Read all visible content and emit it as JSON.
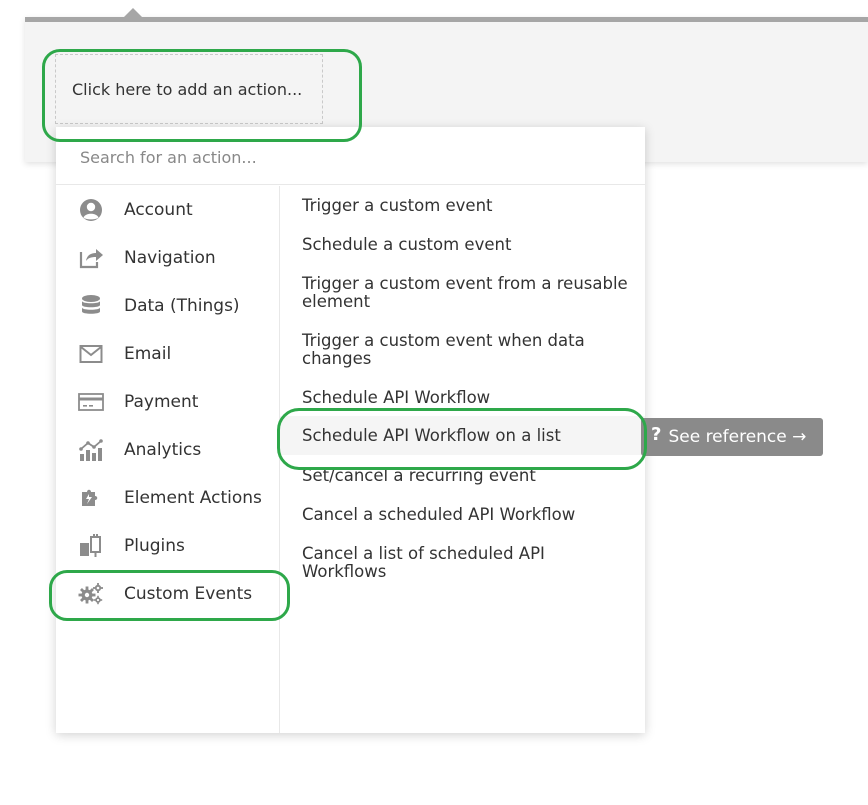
{
  "panel": {
    "add_action_label": "Click here to add an action..."
  },
  "search": {
    "placeholder": "Search for an action..."
  },
  "categories": [
    {
      "label": "Account",
      "icon": "account-icon"
    },
    {
      "label": "Navigation",
      "icon": "share-icon"
    },
    {
      "label": "Data (Things)",
      "icon": "database-icon"
    },
    {
      "label": "Email",
      "icon": "envelope-icon"
    },
    {
      "label": "Payment",
      "icon": "credit-card-icon"
    },
    {
      "label": "Analytics",
      "icon": "chart-icon"
    },
    {
      "label": "Element Actions",
      "icon": "puzzle-icon"
    },
    {
      "label": "Plugins",
      "icon": "plug-icon"
    },
    {
      "label": "Custom Events",
      "icon": "gears-icon"
    }
  ],
  "actions": [
    "Trigger a custom event",
    "Schedule a custom event",
    "Trigger a custom event from a reusable element",
    "Trigger a custom event when data changes",
    "Schedule API Workflow",
    "Schedule API Workflow on a list",
    "Set/cancel a recurring event",
    "Cancel a scheduled API Workflow",
    "Cancel a list of scheduled API Workflows"
  ],
  "see_reference": {
    "icon": "?",
    "label": "See reference →"
  },
  "colors": {
    "annotation": "#2ea84a",
    "icon_gray": "#8c8c8c",
    "tooltip_bg": "#8a8a8a"
  }
}
